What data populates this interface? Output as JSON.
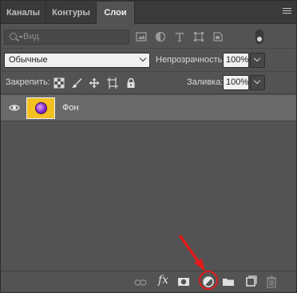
{
  "tabs": [
    {
      "label": "Каналы",
      "active": false
    },
    {
      "label": "Контуры",
      "active": false
    },
    {
      "label": "Слои",
      "active": true
    }
  ],
  "filter": {
    "kind_label": "Вид",
    "icons": [
      "image-filter-icon",
      "adjustment-filter-icon",
      "type-filter-icon",
      "shape-filter-icon",
      "smart-object-filter-icon"
    ],
    "toggle": "filter-toggle"
  },
  "blend": {
    "mode": "Обычные",
    "opacity_label": "Непрозрачность:",
    "opacity_value": "100%"
  },
  "lock": {
    "label": "Закрепить:",
    "icons": [
      "lock-transparent-pixels-icon",
      "lock-image-pixels-icon",
      "lock-position-icon",
      "lock-artboard-icon",
      "lock-all-icon"
    ],
    "fill_label": "Заливка:",
    "fill_value": "100%"
  },
  "layers": [
    {
      "name": "Фон",
      "visible": true,
      "thumbnail_color": "#f3c022"
    }
  ],
  "bottom_icons": [
    "link-layers-icon",
    "fx-icon",
    "add-mask-icon",
    "new-adjustment-layer-icon",
    "new-group-icon",
    "new-layer-icon",
    "delete-icon"
  ],
  "bottom_fx_text": "fx",
  "annotation": {
    "color": "#e21b1b",
    "target": "new-adjustment-layer-icon"
  },
  "colors": {
    "panel": "#535353",
    "tabbar": "#3a3a3a",
    "selected_layer": "#696969"
  }
}
